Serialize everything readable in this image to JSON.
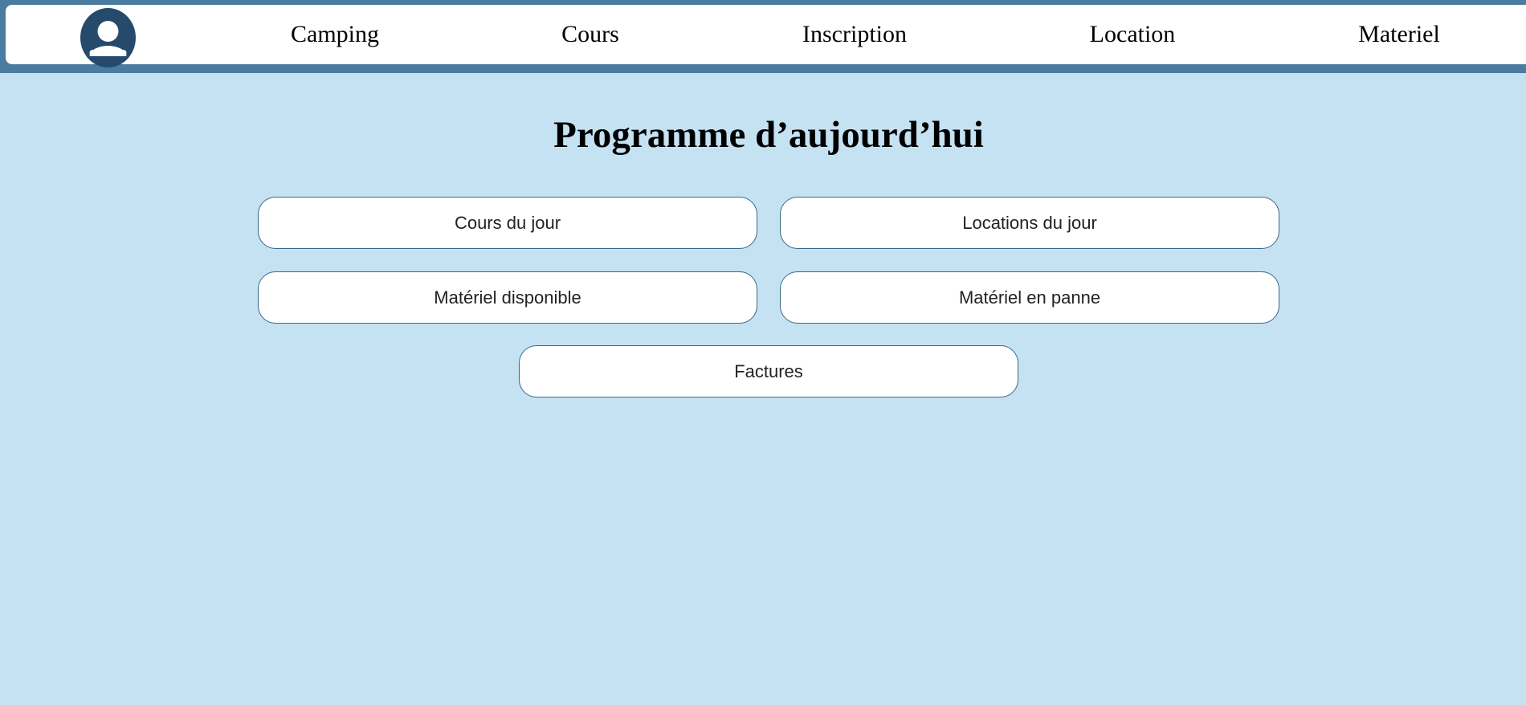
{
  "nav": {
    "avatar_icon": "user-avatar-icon",
    "items": [
      {
        "label": "Camping"
      },
      {
        "label": "Cours"
      },
      {
        "label": "Inscription"
      },
      {
        "label": "Location"
      },
      {
        "label": "Materiel"
      }
    ]
  },
  "main": {
    "title": "Programme d’aujourd’hui",
    "buttons": [
      {
        "label": "Cours du jour"
      },
      {
        "label": "Locations du jour"
      },
      {
        "label": "Matériel disponible"
      },
      {
        "label": "Matériel en panne"
      },
      {
        "label": "Factures"
      }
    ]
  },
  "colors": {
    "background": "#c5e2f3",
    "header_band": "#4a7ba0",
    "avatar": "#264a6c",
    "button_border": "#3b6788"
  }
}
